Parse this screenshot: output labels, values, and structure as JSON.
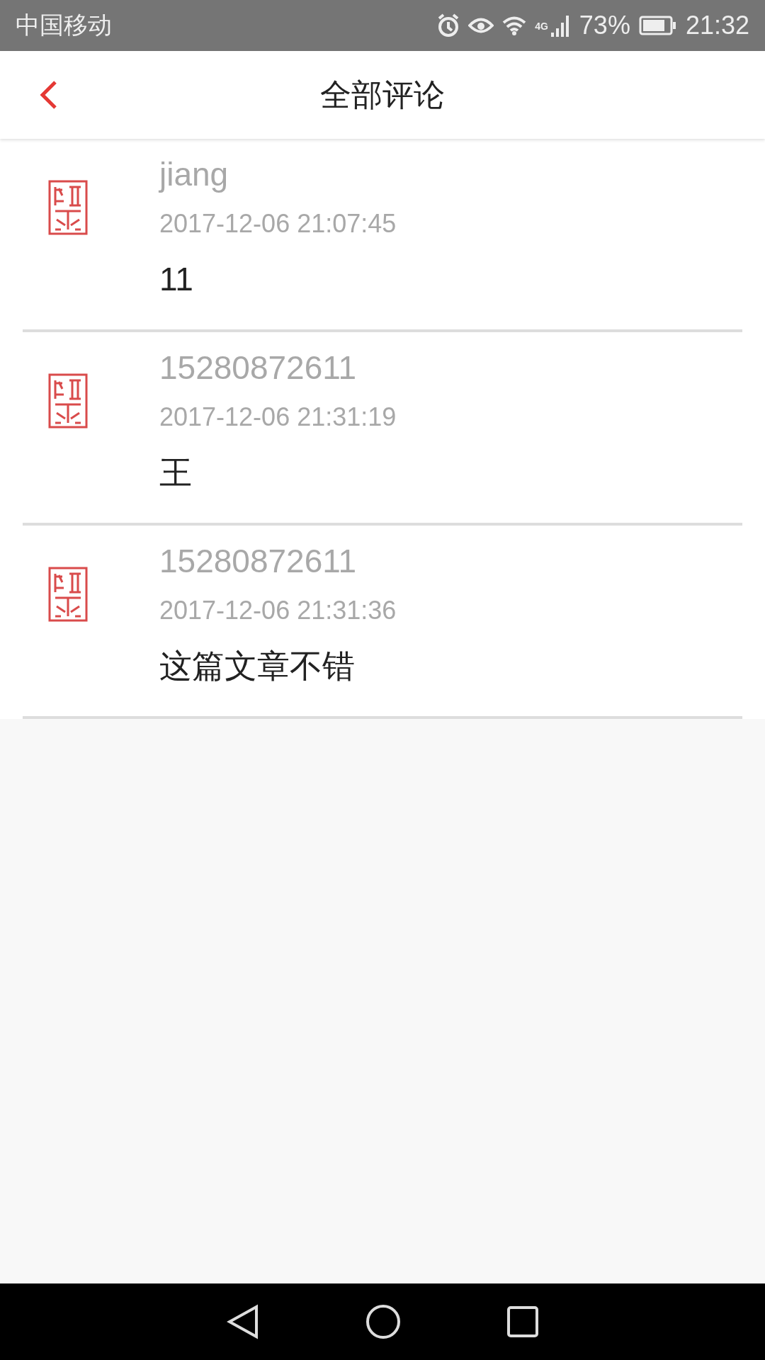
{
  "status_bar": {
    "carrier": "中国移动",
    "network": "4G",
    "battery": "73%",
    "time": "21:32"
  },
  "header": {
    "title": "全部评论"
  },
  "comments": [
    {
      "author": "jiang",
      "time": "2017-12-06 21:07:45",
      "text": "11"
    },
    {
      "author": "15280872611",
      "time": "2017-12-06 21:31:19",
      "text": "王"
    },
    {
      "author": "15280872611",
      "time": "2017-12-06 21:31:36",
      "text": "这篇文章不错"
    }
  ]
}
